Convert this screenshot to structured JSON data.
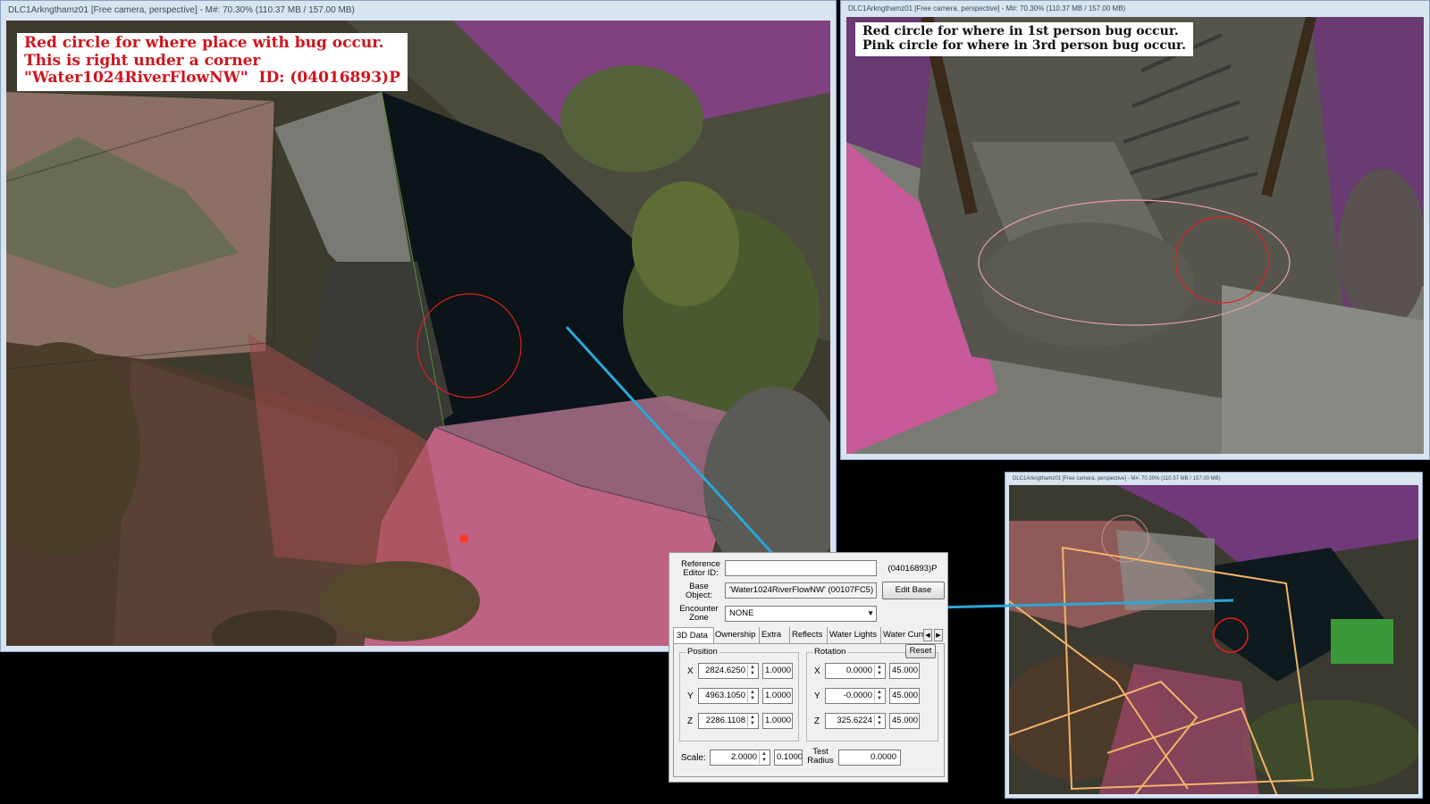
{
  "windows": {
    "main": {
      "title": "DLC1Arkngthamz01 [Free camera, perspective] - M#: 70.30% (110.37 MB / 157.00 MB)",
      "annotation": "Red circle for where place with bug occur.\nThis is right under a corner\n\"Water1024RiverFlowNW\"  ID: (04016893)P"
    },
    "top_right": {
      "title": "DLC1Arkngthamz01 [Free camera, perspective] - M#: 70.30% (110.37 MB / 157.00 MB)",
      "annotation": "Red circle for where in 1st person bug occur.\nPink circle for where in 3rd person bug occur."
    },
    "bottom_right": {
      "title": "DLC1Arkngthamz01 [Free camera, perspective] - M#: 70.30% (110.37 MB / 157.00 MB)"
    }
  },
  "reference_dialog": {
    "editor_id_label": "Reference\nEditor ID:",
    "editor_id_value": "",
    "form_id": "(04016893)P",
    "base_object_label": "Base\nObject:",
    "base_object_value": "'Water1024RiverFlowNW' (00107FC5)",
    "edit_base_button": "Edit Base",
    "encounter_zone_label": "Encounter\nZone",
    "encounter_zone_value": "NONE",
    "tabs": [
      "3D Data",
      "Ownership",
      "Extra",
      "Reflects",
      "Water Lights",
      "Water Curr"
    ],
    "active_tab": "3D Data",
    "position": {
      "title": "Position",
      "x": "2824.6250",
      "y": "4963.1050",
      "z": "2286.1108",
      "x_step": "1.0000",
      "y_step": "1.0000",
      "z_step": "1.0000"
    },
    "rotation": {
      "title": "Rotation",
      "reset_button": "Reset",
      "x": "0.0000",
      "y": "-0.0000",
      "z": "325.6224",
      "x_step": "45.000",
      "y_step": "45.000",
      "z_step": "45.000"
    },
    "axes": [
      "X",
      "Y",
      "Z"
    ],
    "scale_label": "Scale:",
    "scale_value": "2.0000",
    "scale_step": "0.1000",
    "test_radius_label": "Test\nRadius",
    "test_radius_value": "0.0000"
  },
  "colors": {
    "window_frame": "#d9e4f1",
    "annotation_red": "#d0141c",
    "bug_circle_red": "#e02020",
    "bug_circle_pink": "#e8a0a8",
    "connector_line": "#2aa7d8",
    "navmesh_pink": "#d9688f",
    "navmesh_purple": "#7a3a8a",
    "outline_orange": "#f2b46a"
  }
}
